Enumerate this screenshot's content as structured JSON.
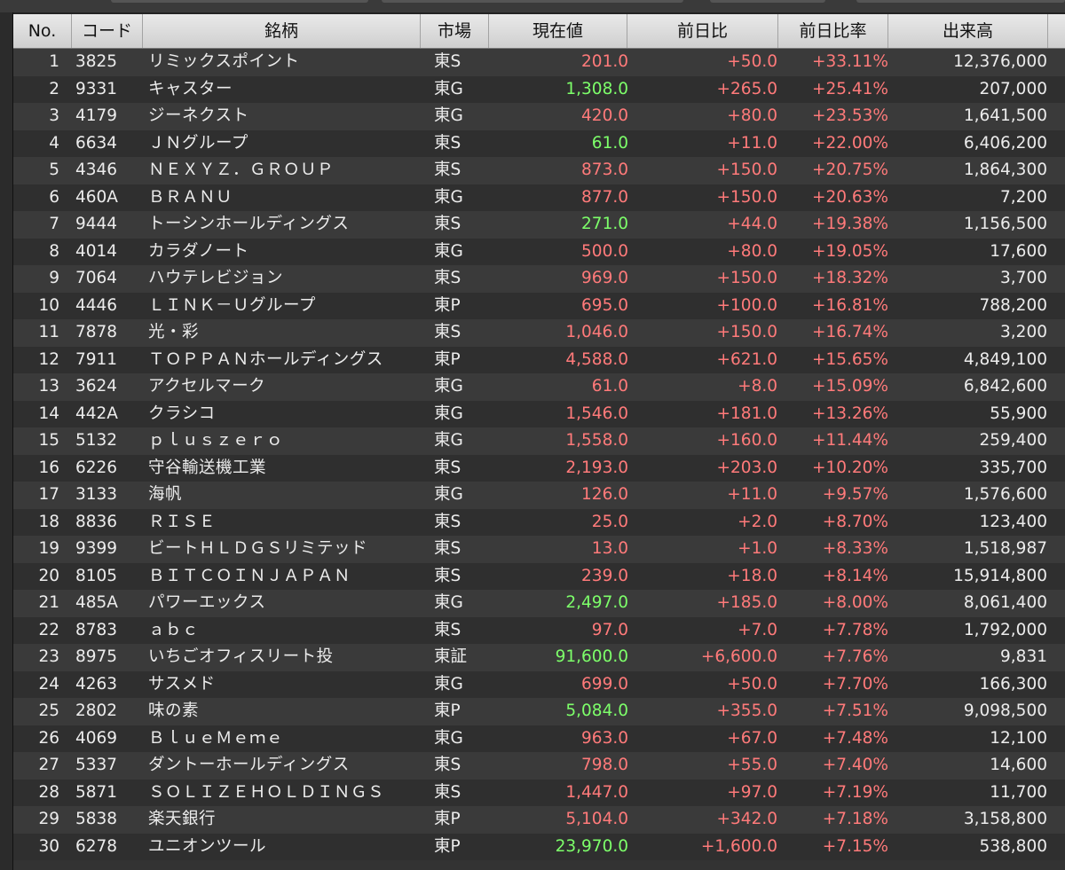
{
  "colors": {
    "header_bg": "#d9d9d9",
    "row_odd": "#3a3a3a",
    "row_even": "#2f2f2f",
    "text": "#ececec",
    "up_red": "#ff7a7a",
    "highlight_green": "#7dff6a"
  },
  "columns": [
    "No.",
    "コード",
    "銘柄",
    "市場",
    "現在値",
    "前日比",
    "前日比率",
    "出来高"
  ],
  "rows": [
    {
      "no": "1",
      "code": "3825",
      "name": "リミックスポイント",
      "market": "東S",
      "price": "201.0",
      "price_color": "red",
      "change": "+50.0",
      "pct": "+33.11%",
      "volume": "12,376,000"
    },
    {
      "no": "2",
      "code": "9331",
      "name": "キャスター",
      "market": "東G",
      "price": "1,308.0",
      "price_color": "green",
      "change": "+265.0",
      "pct": "+25.41%",
      "volume": "207,000"
    },
    {
      "no": "3",
      "code": "4179",
      "name": "ジーネクスト",
      "market": "東G",
      "price": "420.0",
      "price_color": "red",
      "change": "+80.0",
      "pct": "+23.53%",
      "volume": "1,641,500"
    },
    {
      "no": "4",
      "code": "6634",
      "name": "ＪＮグループ",
      "market": "東S",
      "price": "61.0",
      "price_color": "green",
      "change": "+11.0",
      "pct": "+22.00%",
      "volume": "6,406,200"
    },
    {
      "no": "5",
      "code": "4346",
      "name": "ＮＥＸＹＺ．ＧＲＯＵＰ",
      "market": "東S",
      "price": "873.0",
      "price_color": "red",
      "change": "+150.0",
      "pct": "+20.75%",
      "volume": "1,864,300"
    },
    {
      "no": "6",
      "code": "460A",
      "name": "ＢＲＡＮＵ",
      "market": "東G",
      "price": "877.0",
      "price_color": "red",
      "change": "+150.0",
      "pct": "+20.63%",
      "volume": "7,200"
    },
    {
      "no": "7",
      "code": "9444",
      "name": "トーシンホールディングス",
      "market": "東S",
      "price": "271.0",
      "price_color": "green",
      "change": "+44.0",
      "pct": "+19.38%",
      "volume": "1,156,500"
    },
    {
      "no": "8",
      "code": "4014",
      "name": "カラダノート",
      "market": "東G",
      "price": "500.0",
      "price_color": "red",
      "change": "+80.0",
      "pct": "+19.05%",
      "volume": "17,600"
    },
    {
      "no": "9",
      "code": "7064",
      "name": "ハウテレビジョン",
      "market": "東S",
      "price": "969.0",
      "price_color": "red",
      "change": "+150.0",
      "pct": "+18.32%",
      "volume": "3,700"
    },
    {
      "no": "10",
      "code": "4446",
      "name": "ＬＩＮＫ－Ｕグループ",
      "market": "東P",
      "price": "695.0",
      "price_color": "red",
      "change": "+100.0",
      "pct": "+16.81%",
      "volume": "788,200"
    },
    {
      "no": "11",
      "code": "7878",
      "name": "光・彩",
      "market": "東S",
      "price": "1,046.0",
      "price_color": "red",
      "change": "+150.0",
      "pct": "+16.74%",
      "volume": "3,200"
    },
    {
      "no": "12",
      "code": "7911",
      "name": "ＴＯＰＰＡＮホールディングス",
      "market": "東P",
      "price": "4,588.0",
      "price_color": "red",
      "change": "+621.0",
      "pct": "+15.65%",
      "volume": "4,849,100"
    },
    {
      "no": "13",
      "code": "3624",
      "name": "アクセルマーク",
      "market": "東G",
      "price": "61.0",
      "price_color": "red",
      "change": "+8.0",
      "pct": "+15.09%",
      "volume": "6,842,600"
    },
    {
      "no": "14",
      "code": "442A",
      "name": "クラシコ",
      "market": "東G",
      "price": "1,546.0",
      "price_color": "red",
      "change": "+181.0",
      "pct": "+13.26%",
      "volume": "55,900"
    },
    {
      "no": "15",
      "code": "5132",
      "name": "ｐｌｕｓｚｅｒｏ",
      "market": "東G",
      "price": "1,558.0",
      "price_color": "red",
      "change": "+160.0",
      "pct": "+11.44%",
      "volume": "259,400"
    },
    {
      "no": "16",
      "code": "6226",
      "name": "守谷輸送機工業",
      "market": "東S",
      "price": "2,193.0",
      "price_color": "red",
      "change": "+203.0",
      "pct": "+10.20%",
      "volume": "335,700"
    },
    {
      "no": "17",
      "code": "3133",
      "name": "海帆",
      "market": "東G",
      "price": "126.0",
      "price_color": "red",
      "change": "+11.0",
      "pct": "+9.57%",
      "volume": "1,576,600"
    },
    {
      "no": "18",
      "code": "8836",
      "name": "ＲＩＳＥ",
      "market": "東S",
      "price": "25.0",
      "price_color": "red",
      "change": "+2.0",
      "pct": "+8.70%",
      "volume": "123,400"
    },
    {
      "no": "19",
      "code": "9399",
      "name": "ビートＨＬＤＧＳリミテッド",
      "market": "東S",
      "price": "13.0",
      "price_color": "red",
      "change": "+1.0",
      "pct": "+8.33%",
      "volume": "1,518,987"
    },
    {
      "no": "20",
      "code": "8105",
      "name": "ＢＩＴＣＯＩＮＪＡＰＡＮ",
      "market": "東S",
      "price": "239.0",
      "price_color": "red",
      "change": "+18.0",
      "pct": "+8.14%",
      "volume": "15,914,800"
    },
    {
      "no": "21",
      "code": "485A",
      "name": "パワーエックス",
      "market": "東G",
      "price": "2,497.0",
      "price_color": "green",
      "change": "+185.0",
      "pct": "+8.00%",
      "volume": "8,061,400"
    },
    {
      "no": "22",
      "code": "8783",
      "name": "ａｂｃ",
      "market": "東S",
      "price": "97.0",
      "price_color": "red",
      "change": "+7.0",
      "pct": "+7.78%",
      "volume": "1,792,000"
    },
    {
      "no": "23",
      "code": "8975",
      "name": "いちごオフィスリート投",
      "market": "東証",
      "price": "91,600.0",
      "price_color": "green",
      "change": "+6,600.0",
      "pct": "+7.76%",
      "volume": "9,831"
    },
    {
      "no": "24",
      "code": "4263",
      "name": "サスメド",
      "market": "東G",
      "price": "699.0",
      "price_color": "red",
      "change": "+50.0",
      "pct": "+7.70%",
      "volume": "166,300"
    },
    {
      "no": "25",
      "code": "2802",
      "name": "味の素",
      "market": "東P",
      "price": "5,084.0",
      "price_color": "green",
      "change": "+355.0",
      "pct": "+7.51%",
      "volume": "9,098,500"
    },
    {
      "no": "26",
      "code": "4069",
      "name": "ＢｌｕｅＭｅｍｅ",
      "market": "東G",
      "price": "963.0",
      "price_color": "red",
      "change": "+67.0",
      "pct": "+7.48%",
      "volume": "12,100"
    },
    {
      "no": "27",
      "code": "5337",
      "name": "ダントーホールディングス",
      "market": "東S",
      "price": "798.0",
      "price_color": "red",
      "change": "+55.0",
      "pct": "+7.40%",
      "volume": "14,600"
    },
    {
      "no": "28",
      "code": "5871",
      "name": "ＳＯＬＩＺＥＨＯＬＤＩＮＧＳ",
      "market": "東S",
      "price": "1,447.0",
      "price_color": "red",
      "change": "+97.0",
      "pct": "+7.19%",
      "volume": "11,700"
    },
    {
      "no": "29",
      "code": "5838",
      "name": "楽天銀行",
      "market": "東P",
      "price": "5,104.0",
      "price_color": "red",
      "change": "+342.0",
      "pct": "+7.18%",
      "volume": "3,158,800"
    },
    {
      "no": "30",
      "code": "6278",
      "name": "ユニオンツール",
      "market": "東P",
      "price": "23,970.0",
      "price_color": "green",
      "change": "+1,600.0",
      "pct": "+7.15%",
      "volume": "538,800"
    }
  ]
}
